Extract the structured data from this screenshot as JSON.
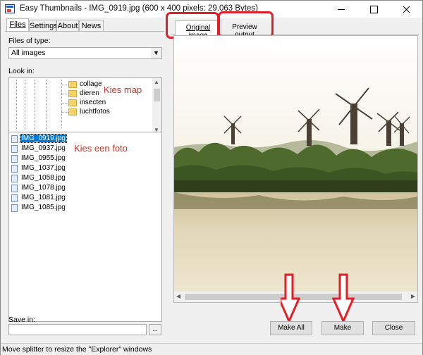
{
  "window": {
    "title": "Easy Thumbnails - IMG_0919.jpg  (600 x 400 pixels: 29.063 Bytes)"
  },
  "left_tabs": [
    "Files",
    "Settings",
    "About",
    "News"
  ],
  "files_panel": {
    "filetype_label": "Files of type:",
    "filetype_value": "All images",
    "lookin_label": "Look in:",
    "folders": [
      "collage",
      "dieren",
      "insecten",
      "luchtfotos"
    ],
    "files": [
      "IMG_0919.jpg",
      "IMG_0937.jpg",
      "IMG_0955.jpg",
      "IMG_1037.jpg",
      "IMG_1058.jpg",
      "IMG_1078.jpg",
      "IMG_1081.jpg",
      "IMG_1085.jpg"
    ],
    "selected_file": "IMG_0919.jpg",
    "savein_label": "Save in:",
    "savein_value": "",
    "browse_label": "..."
  },
  "annotations": {
    "folder_hint": "Kies map",
    "photo_hint": "Kies een foto",
    "color": "#e21f26"
  },
  "right_tabs": [
    "Original image",
    "Preview output"
  ],
  "buttons": {
    "make_all": "Make All",
    "make": "Make",
    "close": "Close"
  },
  "status": "Move splitter to resize the \"Explorer\" windows",
  "icons": [
    "app-icon",
    "minimize-icon",
    "maximize-icon",
    "close-icon",
    "folder-icon",
    "file-icon",
    "down-arrow-icon"
  ]
}
